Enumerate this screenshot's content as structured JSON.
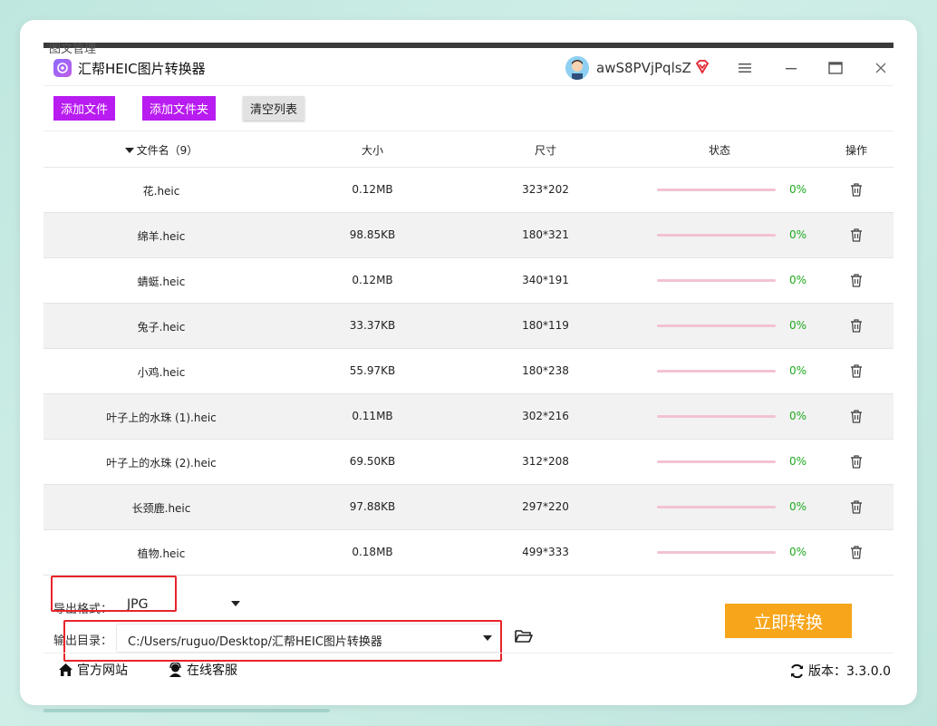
{
  "background_window": {
    "partial_title": "图文管理"
  },
  "app": {
    "title": "汇帮HEIC图片转换器",
    "username": "awS8PVjPqlsZ",
    "accent_purple": "#b81cf0",
    "accent_orange": "#f7a51a"
  },
  "window_controls": [
    "menu-icon",
    "minimize-icon",
    "maximize-icon",
    "close-icon"
  ],
  "toolbar": {
    "add_file": "添加文件",
    "add_folder": "添加文件夹",
    "clear_list": "清空列表"
  },
  "table": {
    "headers": {
      "name": "文件名（9）",
      "size": "大小",
      "dimensions": "尺寸",
      "status": "状态",
      "action": "操作"
    },
    "rows": [
      {
        "name": "花.heic",
        "size": "0.12MB",
        "dimensions": "323*202",
        "progress": "0%"
      },
      {
        "name": "绵羊.heic",
        "size": "98.85KB",
        "dimensions": "180*321",
        "progress": "0%"
      },
      {
        "name": "蜻蜓.heic",
        "size": "0.12MB",
        "dimensions": "340*191",
        "progress": "0%"
      },
      {
        "name": "兔子.heic",
        "size": "33.37KB",
        "dimensions": "180*119",
        "progress": "0%"
      },
      {
        "name": "小鸡.heic",
        "size": "55.97KB",
        "dimensions": "180*238",
        "progress": "0%"
      },
      {
        "name": "叶子上的水珠 (1).heic",
        "size": "0.11MB",
        "dimensions": "302*216",
        "progress": "0%"
      },
      {
        "name": "叶子上的水珠 (2).heic",
        "size": "69.50KB",
        "dimensions": "312*208",
        "progress": "0%"
      },
      {
        "name": "长颈鹿.heic",
        "size": "97.88KB",
        "dimensions": "297*220",
        "progress": "0%"
      },
      {
        "name": "植物.heic",
        "size": "0.18MB",
        "dimensions": "499*333",
        "progress": "0%"
      }
    ]
  },
  "output": {
    "format_label": "导出格式：",
    "format_value": "JPG",
    "dir_label": "输出目录：",
    "dir_value": "C:/Users/ruguo/Desktop/汇帮HEIC图片转换器"
  },
  "convert_button": "立即转换",
  "footer": {
    "website": "官方网站",
    "support": "在线客服",
    "version": "版本：3.3.0.0"
  }
}
